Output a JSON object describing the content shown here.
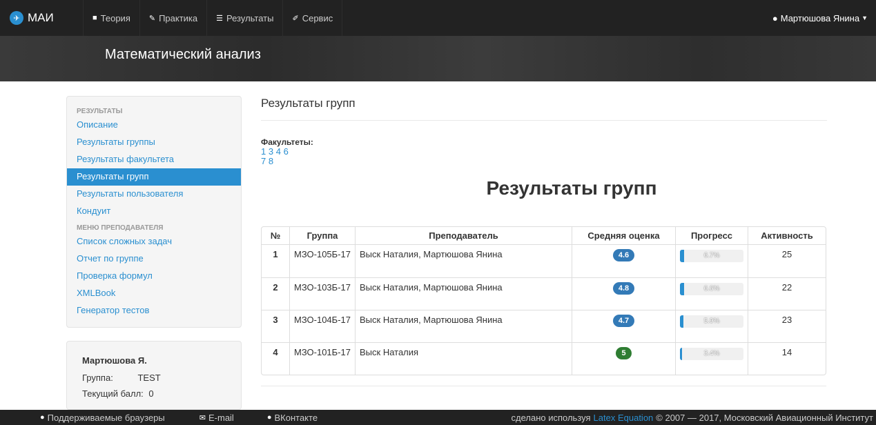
{
  "nav": {
    "brand": "МАИ",
    "items": [
      {
        "icon": "book-icon",
        "label": "Теория"
      },
      {
        "icon": "pencil-icon",
        "label": "Практика"
      },
      {
        "icon": "list-icon",
        "label": "Результаты"
      },
      {
        "icon": "wrench-icon",
        "label": "Сервис"
      }
    ],
    "user": "Мартюшова Янина"
  },
  "banner": {
    "title": "Математический анализ"
  },
  "sidebar": {
    "header_results": "РЕЗУЛЬТАТЫ",
    "items": [
      {
        "label": "Описание"
      },
      {
        "label": "Результаты группы"
      },
      {
        "label": "Результаты факультета"
      },
      {
        "label": "Результаты групп",
        "active": true
      },
      {
        "label": "Результаты пользователя"
      },
      {
        "label": "Кондуит"
      }
    ],
    "header_teacher": "МЕНЮ ПРЕПОДАВАТЕЛЯ",
    "teacher_items": [
      {
        "label": "Список сложных задач"
      },
      {
        "label": "Отчет по группе"
      },
      {
        "label": "Проверка формул"
      },
      {
        "label": "XMLBook"
      },
      {
        "label": "Генератор тестов"
      }
    ]
  },
  "userbox": {
    "name": "Мартюшова Я.",
    "group_label": "Группа:",
    "group_value": "TEST",
    "score_label": "Текущий балл:",
    "score_value": "0"
  },
  "main": {
    "page_title": "Результаты групп",
    "faculties_label": "Факультеты:",
    "faculties": [
      "1",
      "3",
      "4",
      "6",
      "7",
      "8"
    ],
    "big_title": "Результаты групп",
    "table": {
      "headers": [
        "№",
        "Группа",
        "Преподаватель",
        "Средняя оценка",
        "Прогресс",
        "Активность"
      ],
      "rows": [
        {
          "num": "1",
          "group": "МЗО-105Б-17",
          "teacher": "Выск Наталия, Мартюшова Янина",
          "score": "4.6",
          "progress": "6.7%",
          "progress_value": 6.7,
          "activity": "25",
          "badge_color": "#337ab7"
        },
        {
          "num": "2",
          "group": "МЗО-103Б-17",
          "teacher": "Выск Наталия, Мартюшова Янина",
          "score": "4.8",
          "progress": "6.6%",
          "progress_value": 6.6,
          "activity": "22",
          "badge_color": "#337ab7"
        },
        {
          "num": "3",
          "group": "МЗО-104Б-17",
          "teacher": "Выск Наталия, Мартюшова Янина",
          "score": "4.7",
          "progress": "5.9%",
          "progress_value": 5.9,
          "activity": "23",
          "badge_color": "#337ab7"
        },
        {
          "num": "4",
          "group": "МЗО-101Б-17",
          "teacher": "Выск Наталия",
          "score": "5",
          "progress": "3.4%",
          "progress_value": 3.4,
          "activity": "14",
          "badge_color": "#2e7d32"
        }
      ]
    }
  },
  "footer": {
    "browsers": "Поддерживаемые браузеры",
    "email": "E-mail",
    "vk": "ВКонтакте",
    "made_with": "сделано используя",
    "latex": "Latex Equation",
    "copyright": "© 2007 — 2017, Московский Авиационный Институт"
  }
}
